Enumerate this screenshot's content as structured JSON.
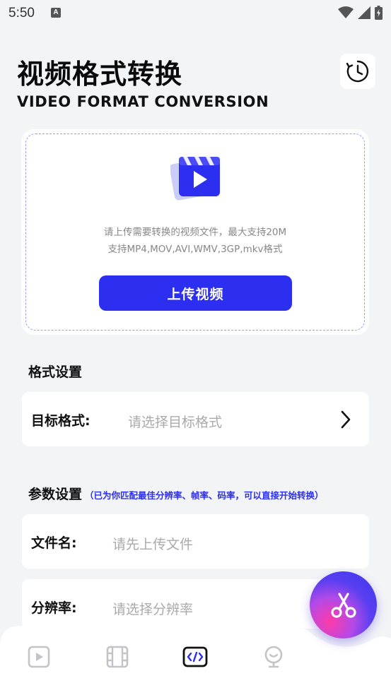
{
  "status_bar": {
    "time": "5:50",
    "notification_icon": "a-letter-icon",
    "wifi_icon": "wifi-icon",
    "signal_icon": "signal-icon",
    "battery_icon": "battery-charging-icon"
  },
  "header": {
    "title": "视频格式转换",
    "subtitle": "VIDEO FORMAT CONVERSION",
    "history_icon": "clock-history-icon"
  },
  "upload": {
    "illustration_icon": "video-clapper-icon",
    "hint_line1": "请上传需要转换的视频文件，最大支持20M",
    "hint_line2": "支持MP4,MOV,AVI,WMV,3GP,mkv格式",
    "button_label": "上传视频"
  },
  "format_settings": {
    "section_title": "格式设置",
    "target_label": "目标格式:",
    "target_placeholder": "请选择目标格式"
  },
  "param_settings": {
    "section_title": "参数设置",
    "section_note": "（已为你匹配最佳分辨率、帧率、码率，可以直接开始转换）",
    "filename_label": "文件名:",
    "filename_placeholder": "请先上传文件",
    "resolution_label": "分辨率:",
    "resolution_placeholder": "请选择分辨率"
  },
  "fab": {
    "icon": "scissors-icon"
  },
  "bottom_nav": {
    "items": [
      {
        "icon": "play-icon",
        "active": false
      },
      {
        "icon": "film-icon",
        "active": false
      },
      {
        "icon": "code-icon",
        "active": true
      },
      {
        "icon": "profile-icon",
        "active": false
      }
    ]
  },
  "colors": {
    "accent": "#2c2ef0",
    "background": "#f3f4f6",
    "dash_border": "#9a9cf0",
    "placeholder": "#aaaaaa"
  }
}
